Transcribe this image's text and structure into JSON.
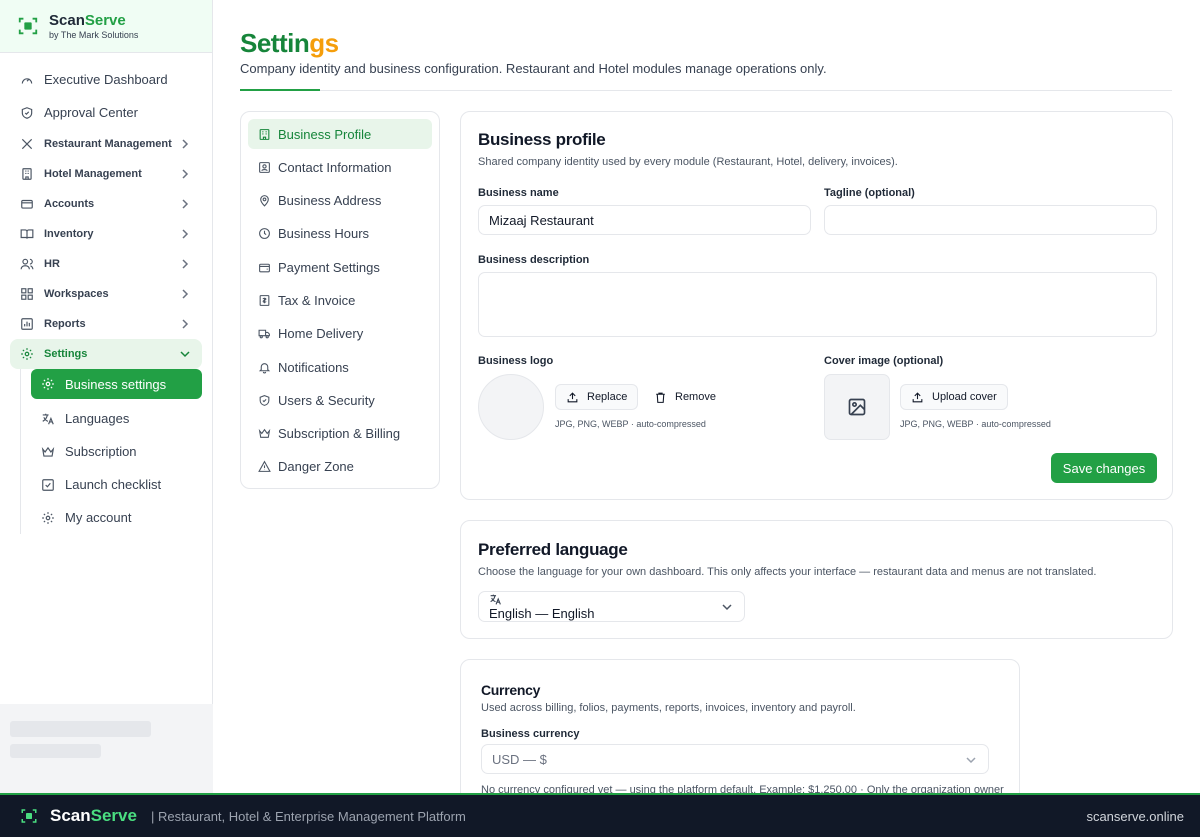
{
  "brand": {
    "name_a": "Scan",
    "name_b": "Serve",
    "sub": "by The Mark Solutions"
  },
  "sidebar": {
    "top_items": [
      {
        "label": "Executive Dashboard"
      },
      {
        "label": "Approval Center"
      }
    ],
    "groups": [
      {
        "label": "Restaurant Management"
      },
      {
        "label": "Hotel Management"
      },
      {
        "label": "Accounts"
      },
      {
        "label": "Inventory"
      },
      {
        "label": "HR"
      },
      {
        "label": "Workspaces"
      },
      {
        "label": "Reports"
      },
      {
        "label": "Settings"
      }
    ],
    "settings_sub": [
      {
        "label": "Business settings"
      },
      {
        "label": "Languages"
      },
      {
        "label": "Subscription"
      },
      {
        "label": "Launch checklist"
      },
      {
        "label": "My account"
      }
    ]
  },
  "page": {
    "title_main": "Settin",
    "title_fade": "gs",
    "subtitle": "Company identity and business configuration. Restaurant and Hotel modules manage operations only."
  },
  "settings_menu": [
    {
      "label": "Business Profile"
    },
    {
      "label": "Contact Information"
    },
    {
      "label": "Business Address"
    },
    {
      "label": "Business Hours"
    },
    {
      "label": "Payment Settings"
    },
    {
      "label": "Tax & Invoice"
    },
    {
      "label": "Home Delivery"
    },
    {
      "label": "Notifications"
    },
    {
      "label": "Users & Security"
    },
    {
      "label": "Subscription & Billing"
    },
    {
      "label": "Danger Zone"
    }
  ],
  "profile": {
    "title": "Business profile",
    "desc": "Shared company identity used by every module (Restaurant, Hotel, delivery, invoices).",
    "name_label": "Business name",
    "name_value": "Mizaaj Restaurant",
    "tagline_label": "Tagline (optional)",
    "tagline_value": "",
    "description_label": "Business description",
    "description_value": "",
    "logo_label": "Business logo",
    "replace_label": "Replace",
    "remove_label": "Remove",
    "logo_hint": "JPG, PNG, WEBP · auto-compressed",
    "cover_label": "Cover image (optional)",
    "upload_cover_label": "Upload cover",
    "cover_hint": "JPG, PNG, WEBP · auto-compressed",
    "save_label": "Save changes"
  },
  "language": {
    "title": "Preferred language",
    "desc": "Choose the language for your own dashboard. This only affects your interface — restaurant data and menus are not translated.",
    "selected": "English — English"
  },
  "currency": {
    "title": "Currency",
    "desc": "Used across billing, folios, payments, reports, invoices, inventory and payroll.",
    "field_label": "Business currency",
    "selected": "USD — $",
    "note": "No currency configured yet — using the platform default. Example: $1,250.00 · Only the organization owner"
  },
  "footer": {
    "name_a": "Scan",
    "name_b": "Serve",
    "tagline": "| Restaurant, Hotel & Enterprise Management Platform",
    "site": "scanserve.online"
  }
}
